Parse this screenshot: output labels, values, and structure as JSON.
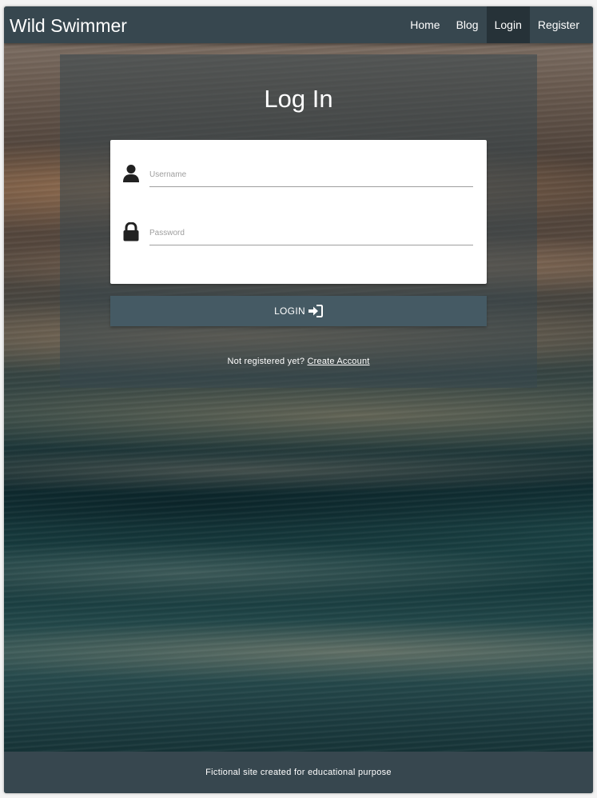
{
  "brand": "Wild Swimmer",
  "nav": {
    "home": "Home",
    "blog": "Blog",
    "login": "Login",
    "register": "Register"
  },
  "login": {
    "title": "Log In",
    "username_placeholder": "Username",
    "password_placeholder": "Password",
    "button_label": "LOGIN",
    "signup_prompt": "Not registered yet?",
    "signup_link": "Create Account"
  },
  "footer": {
    "text": "Fictional site created for educational purpose"
  },
  "colors": {
    "navbar": "#37474f",
    "active_nav": "#263238",
    "button": "#455a64"
  },
  "icons": {
    "username": "user-icon",
    "password": "lock-icon",
    "login_button": "sign-in-icon"
  }
}
